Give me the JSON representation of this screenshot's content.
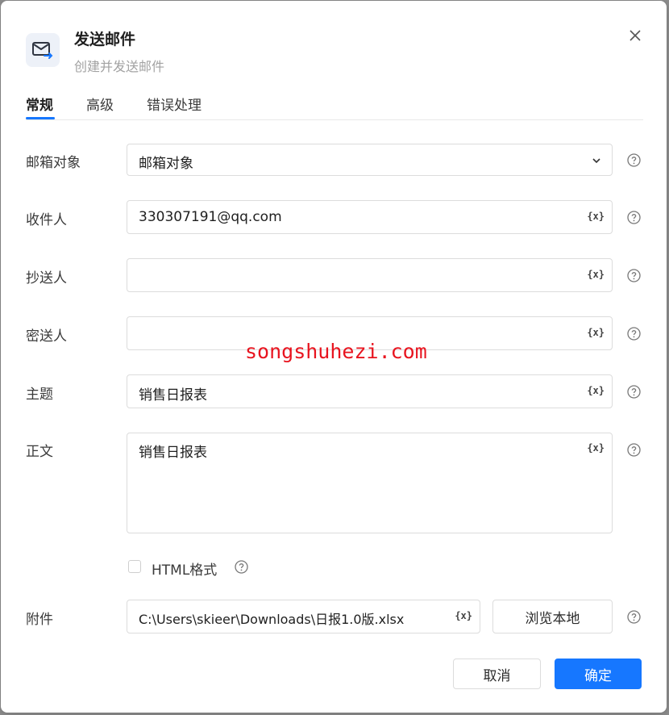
{
  "dialog": {
    "title": "发送邮件",
    "subtitle": "创建并发送邮件",
    "icons": {
      "header": "mail-send-icon",
      "close": "close-icon"
    }
  },
  "tabs": [
    {
      "label": "常规",
      "active": true
    },
    {
      "label": "高级",
      "active": false
    },
    {
      "label": "错误处理",
      "active": false
    }
  ],
  "form": {
    "mailbox": {
      "label": "邮箱对象",
      "value": "邮箱对象"
    },
    "recipient": {
      "label": "收件人",
      "value": "330307191@qq.com"
    },
    "cc": {
      "label": "抄送人",
      "value": ""
    },
    "bcc": {
      "label": "密送人",
      "value": ""
    },
    "subject": {
      "label": "主题",
      "value": "销售日报表"
    },
    "body": {
      "label": "正文",
      "value": "销售日报表"
    },
    "html_format": {
      "label": "HTML格式",
      "checked": false
    },
    "attachment": {
      "label": "附件",
      "value": "C:\\Users\\skieer\\Downloads\\日报1.0版.xlsx",
      "browse_label": "浏览本地"
    },
    "variable_token": "{x}"
  },
  "footer": {
    "cancel_label": "取消",
    "ok_label": "确定"
  },
  "watermark": "songshuhezi.com",
  "colors": {
    "accent": "#1677ff",
    "watermark": "#e8141f"
  }
}
